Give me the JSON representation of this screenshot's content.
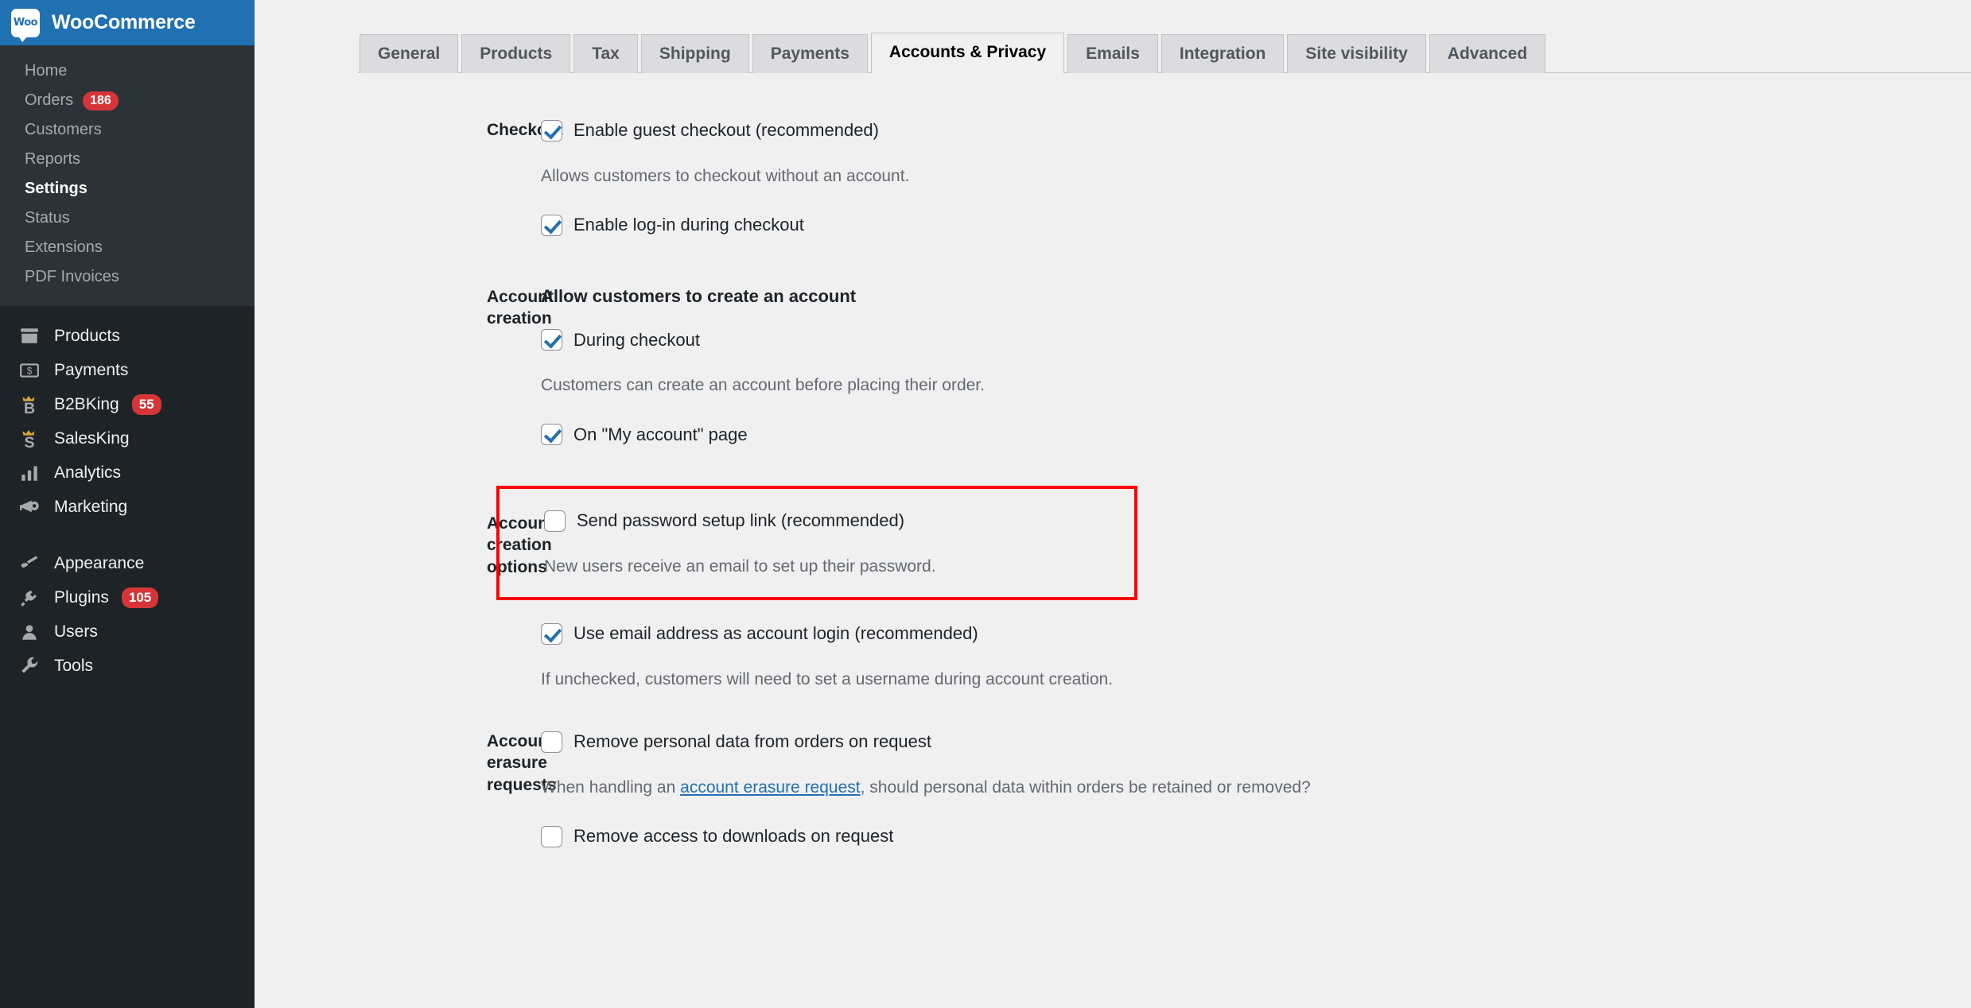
{
  "sidebar": {
    "brand": {
      "logo_text": "Woo",
      "title": "WooCommerce"
    },
    "submenu": [
      {
        "label": "Home",
        "badge": null,
        "current": false
      },
      {
        "label": "Orders",
        "badge": "186",
        "current": false
      },
      {
        "label": "Customers",
        "badge": null,
        "current": false
      },
      {
        "label": "Reports",
        "badge": null,
        "current": false
      },
      {
        "label": "Settings",
        "badge": null,
        "current": true
      },
      {
        "label": "Status",
        "badge": null,
        "current": false
      },
      {
        "label": "Extensions",
        "badge": null,
        "current": false
      },
      {
        "label": "PDF Invoices",
        "badge": null,
        "current": false
      }
    ],
    "menu_group_1": [
      {
        "label": "Products",
        "icon": "products-icon",
        "badge": null
      },
      {
        "label": "Payments",
        "icon": "payments-icon",
        "badge": null
      },
      {
        "label": "B2BKing",
        "icon": "b2bking-icon",
        "badge": "55"
      },
      {
        "label": "SalesKing",
        "icon": "salesking-icon",
        "badge": null
      },
      {
        "label": "Analytics",
        "icon": "analytics-icon",
        "badge": null
      },
      {
        "label": "Marketing",
        "icon": "marketing-icon",
        "badge": null
      }
    ],
    "menu_group_2": [
      {
        "label": "Appearance",
        "icon": "appearance-icon",
        "badge": null
      },
      {
        "label": "Plugins",
        "icon": "plugins-icon",
        "badge": "105"
      },
      {
        "label": "Users",
        "icon": "users-icon",
        "badge": null
      },
      {
        "label": "Tools",
        "icon": "tools-icon",
        "badge": null
      }
    ],
    "colors": {
      "header_blue": "#2071b1",
      "submenu_bg": "#2c3338",
      "menu_bg": "#1d2327",
      "badge_red": "#d63638"
    }
  },
  "tabs": [
    {
      "label": "General",
      "active": false
    },
    {
      "label": "Products",
      "active": false
    },
    {
      "label": "Tax",
      "active": false
    },
    {
      "label": "Shipping",
      "active": false
    },
    {
      "label": "Payments",
      "active": false
    },
    {
      "label": "Accounts & Privacy",
      "active": true
    },
    {
      "label": "Emails",
      "active": false
    },
    {
      "label": "Integration",
      "active": false
    },
    {
      "label": "Site visibility",
      "active": false
    },
    {
      "label": "Advanced",
      "active": false
    }
  ],
  "sections": {
    "checkout": {
      "label": "Checkout",
      "guest_checkout": {
        "label": "Enable guest checkout (recommended)",
        "checked": true,
        "description": "Allows customers to checkout without an account."
      },
      "login_during_checkout": {
        "label": "Enable log-in during checkout",
        "checked": true
      }
    },
    "account_creation": {
      "label": "Account creation",
      "heading": "Allow customers to create an account",
      "during_checkout": {
        "label": "During checkout",
        "checked": true,
        "description": "Customers can create an account before placing their order."
      },
      "my_account_page": {
        "label": "On \"My account\" page",
        "checked": true
      }
    },
    "account_creation_options": {
      "label": "Account creation options",
      "highlight_color": "#ff0000",
      "send_password_setup_link": {
        "label": "Send password setup link (recommended)",
        "checked": false,
        "description": "New users receive an email to set up their password."
      },
      "use_email_as_login": {
        "label": "Use email address as account login (recommended)",
        "checked": true,
        "description": "If unchecked, customers will need to set a username during account creation."
      }
    },
    "account_erasure": {
      "label": "Account erasure requests",
      "remove_personal_data": {
        "label": "Remove personal data from orders on request",
        "checked": false,
        "description_pre": "When handling an ",
        "description_link": "account erasure request",
        "description_post": ", should personal data within orders be retained or removed?"
      },
      "remove_downloads": {
        "label": "Remove access to downloads on request",
        "checked": false
      }
    }
  }
}
